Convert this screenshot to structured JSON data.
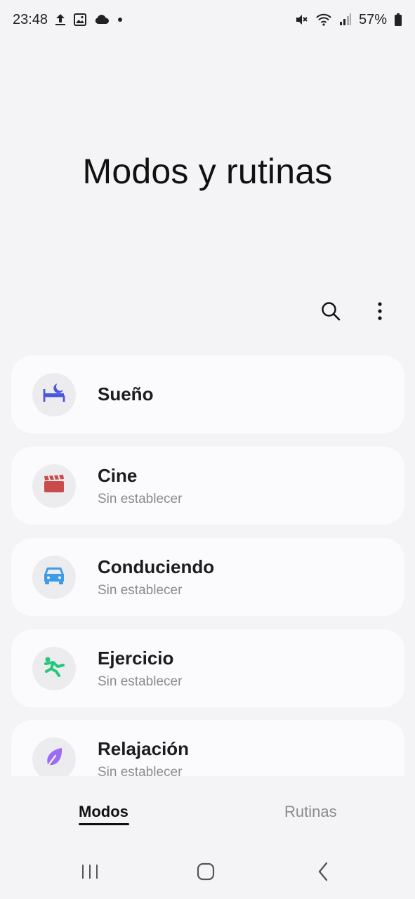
{
  "status_bar": {
    "time": "23:48",
    "battery": "57%",
    "icons": [
      "upload-icon",
      "image-icon",
      "cloud-icon",
      "dot-icon",
      "mute-icon",
      "wifi-icon",
      "signal-icon",
      "battery-icon"
    ]
  },
  "page": {
    "title": "Modos y rutinas"
  },
  "toolbar": {
    "icons": [
      "search-icon",
      "more-options-icon"
    ]
  },
  "modes": [
    {
      "name": "Sueño",
      "status": "",
      "icon": "bed-icon",
      "color": "#4a56e2"
    },
    {
      "name": "Cine",
      "status": "Sin establecer",
      "icon": "clapperboard-icon",
      "color": "#c94b4b"
    },
    {
      "name": "Conduciendo",
      "status": "Sin establecer",
      "icon": "car-icon",
      "color": "#3d9be9"
    },
    {
      "name": "Ejercicio",
      "status": "Sin establecer",
      "icon": "running-icon",
      "color": "#25c77a"
    },
    {
      "name": "Relajación",
      "status": "Sin establecer",
      "icon": "leaf-icon",
      "color": "#9b6cf2"
    }
  ],
  "tabs": {
    "modos": "Modos",
    "rutinas": "Rutinas",
    "active": "Modos"
  },
  "nav": {
    "icons": [
      "recent-apps-icon",
      "home-icon",
      "back-icon"
    ]
  }
}
